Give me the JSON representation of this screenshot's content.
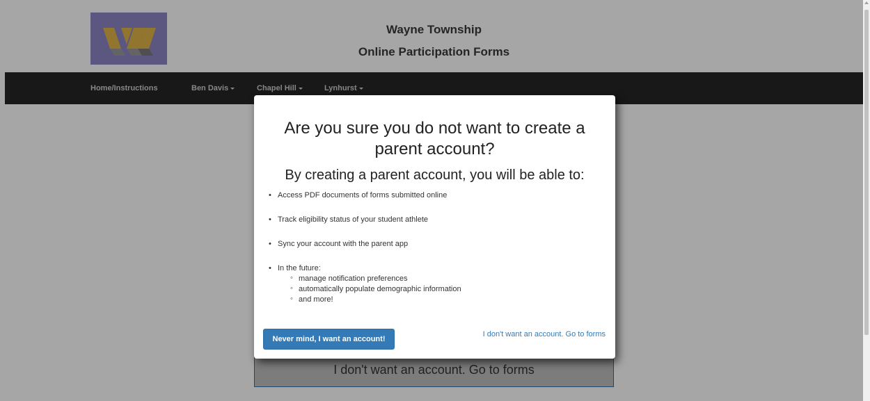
{
  "header": {
    "title_line1": "Wayne Township",
    "title_line2": "Online Participation Forms"
  },
  "navbar": {
    "items": [
      {
        "label": "Home/Instructions",
        "dropdown": false
      },
      {
        "label": "Ben Davis",
        "dropdown": true
      },
      {
        "label": "Chapel Hill",
        "dropdown": true
      },
      {
        "label": "Lynhurst",
        "dropdown": true
      }
    ]
  },
  "background_button": {
    "label": "I don't want an account. Go to forms"
  },
  "modal": {
    "title": "Are you sure you do not want to create a parent account?",
    "subtitle": "By creating a parent account, you will be able to:",
    "bullets": [
      "Access PDF documents of forms submitted online",
      "Track eligibility status of your student athlete",
      "Sync your account with the parent app",
      "In the future:"
    ],
    "future_items": [
      "manage notification preferences",
      "automatically populate demographic information",
      "and more!"
    ],
    "primary_button": "Never mind, I want an account!",
    "secondary_link": "I don't want an account. Go to forms"
  },
  "colors": {
    "primary": "#337ab7",
    "navbar": "#262626",
    "logo_bg": "#8d86c5"
  },
  "icons": {
    "logo": "wayne-w-logo",
    "caret": "caret-down-icon",
    "scroll_up": "scroll-up-arrow-icon"
  }
}
